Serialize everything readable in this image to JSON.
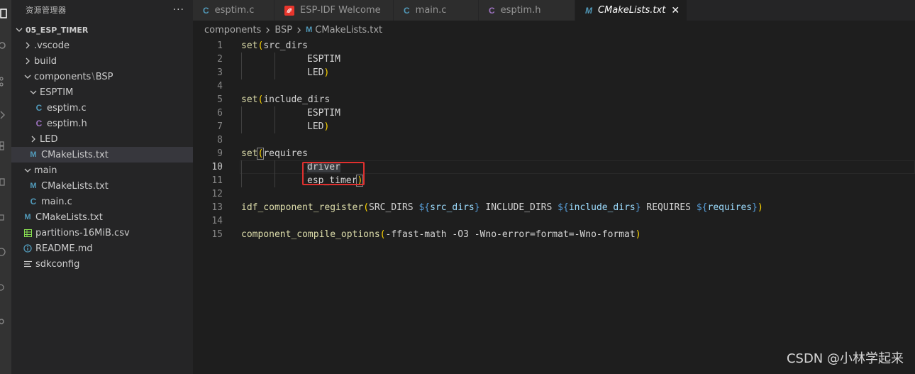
{
  "sidebar": {
    "title": "资源管理器",
    "more": "···",
    "tree": [
      {
        "label": "05_ESP_TIMER",
        "depth": 0,
        "type": "root"
      },
      {
        "label": ".vscode",
        "depth": 1,
        "type": "folder-collapsed"
      },
      {
        "label": "build",
        "depth": 1,
        "type": "folder-collapsed"
      },
      {
        "label": "components",
        "label2": "BSP",
        "depth": 1,
        "type": "folder-open"
      },
      {
        "label": "ESPTIM",
        "depth": 2,
        "type": "folder-open"
      },
      {
        "label": "esptim.c",
        "depth": 3,
        "type": "file-c",
        "icon": "C"
      },
      {
        "label": "esptim.h",
        "depth": 3,
        "type": "file-h",
        "icon": "C"
      },
      {
        "label": "LED",
        "depth": 2,
        "type": "folder-collapsed"
      },
      {
        "label": "CMakeLists.txt",
        "depth": 2,
        "type": "file-m",
        "icon": "M",
        "selected": true
      },
      {
        "label": "main",
        "depth": 1,
        "type": "folder-open"
      },
      {
        "label": "CMakeLists.txt",
        "depth": 2,
        "type": "file-m",
        "icon": "M"
      },
      {
        "label": "main.c",
        "depth": 2,
        "type": "file-c",
        "icon": "C"
      },
      {
        "label": "CMakeLists.txt",
        "depth": 1,
        "type": "file-m",
        "icon": "M"
      },
      {
        "label": "partitions-16MiB.csv",
        "depth": 1,
        "type": "file-csv"
      },
      {
        "label": "README.md",
        "depth": 1,
        "type": "file-info"
      },
      {
        "label": "sdkconfig",
        "depth": 1,
        "type": "file-lines"
      }
    ]
  },
  "tabs": [
    {
      "label": "esptim.c",
      "icon": "C",
      "kind": "c",
      "active": false
    },
    {
      "label": "ESP-IDF Welcome",
      "icon": "esp",
      "kind": "esp",
      "active": false
    },
    {
      "label": "main.c",
      "icon": "C",
      "kind": "c",
      "active": false
    },
    {
      "label": "esptim.h",
      "icon": "C",
      "kind": "h",
      "active": false
    },
    {
      "label": "CMakeLists.txt",
      "icon": "M",
      "kind": "m",
      "active": true,
      "close": "✕"
    }
  ],
  "breadcrumb": {
    "part1": "components",
    "part2": "BSP",
    "file_icon": "M",
    "file": "CMakeLists.txt"
  },
  "editor": {
    "current_line": 10,
    "lines": [
      {
        "n": "1",
        "t": [
          [
            "kw",
            "set"
          ],
          [
            "pn",
            "("
          ],
          [
            "pl",
            "src_dirs"
          ]
        ]
      },
      {
        "n": "2",
        "indent": 2,
        "t": [
          [
            "pl",
            "ESPTIM"
          ]
        ]
      },
      {
        "n": "3",
        "indent": 2,
        "t": [
          [
            "pl",
            "LED"
          ],
          [
            "pn",
            ")"
          ]
        ]
      },
      {
        "n": "4",
        "t": []
      },
      {
        "n": "5",
        "t": [
          [
            "kw",
            "set"
          ],
          [
            "pn",
            "("
          ],
          [
            "pl",
            "include_dirs"
          ]
        ]
      },
      {
        "n": "6",
        "indent": 2,
        "t": [
          [
            "pl",
            "ESPTIM"
          ]
        ]
      },
      {
        "n": "7",
        "indent": 2,
        "t": [
          [
            "pl",
            "LED"
          ],
          [
            "pn",
            ")"
          ]
        ]
      },
      {
        "n": "8",
        "t": []
      },
      {
        "n": "9",
        "t": [
          [
            "kw",
            "set"
          ],
          [
            "pnb",
            "("
          ],
          [
            "pl",
            "requires"
          ]
        ]
      },
      {
        "n": "10",
        "indent": 2,
        "t": [
          [
            "hl",
            "driver"
          ]
        ]
      },
      {
        "n": "11",
        "indent": 2,
        "t": [
          [
            "pl",
            "esp_timer"
          ],
          [
            "pnb",
            ")"
          ]
        ]
      },
      {
        "n": "12",
        "t": []
      },
      {
        "n": "13",
        "t": [
          [
            "fn",
            "idf_component_register"
          ],
          [
            "pn",
            "("
          ],
          [
            "pl",
            "SRC_DIRS "
          ],
          [
            "var",
            "${"
          ],
          [
            "varn",
            "src_dirs"
          ],
          [
            "var",
            "}"
          ],
          [
            "pl",
            " INCLUDE_DIRS "
          ],
          [
            "var",
            "${"
          ],
          [
            "varn",
            "include_dirs"
          ],
          [
            "var",
            "}"
          ],
          [
            "pl",
            " REQUIRES "
          ],
          [
            "var",
            "${"
          ],
          [
            "varn",
            "requires"
          ],
          [
            "var",
            "}"
          ],
          [
            "pn",
            ")"
          ]
        ]
      },
      {
        "n": "14",
        "t": []
      },
      {
        "n": "15",
        "t": [
          [
            "fn",
            "component_compile_options"
          ],
          [
            "pn",
            "("
          ],
          [
            "pl",
            "-ffast-math -O3 -Wno-error=format=-Wno-format"
          ],
          [
            "pn",
            ")"
          ]
        ]
      }
    ]
  },
  "watermark": "CSDN @小林学起来",
  "colors": {
    "annotation_box": "#e0302e",
    "c_icon": "#519aba",
    "h_icon": "#a074c4",
    "esp_icon": "#e7352c"
  }
}
